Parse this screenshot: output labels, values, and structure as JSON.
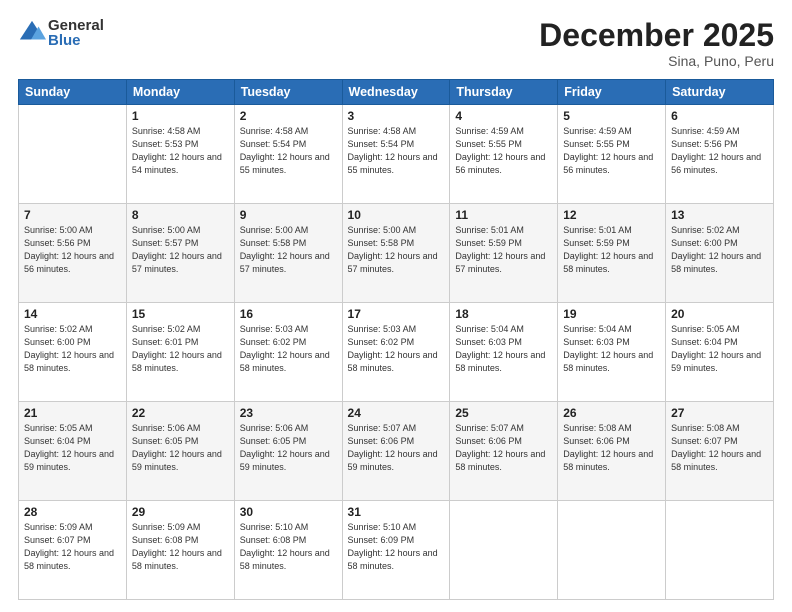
{
  "logo": {
    "general": "General",
    "blue": "Blue"
  },
  "title": "December 2025",
  "location": "Sina, Puno, Peru",
  "headers": [
    "Sunday",
    "Monday",
    "Tuesday",
    "Wednesday",
    "Thursday",
    "Friday",
    "Saturday"
  ],
  "weeks": [
    [
      {
        "day": "",
        "info": ""
      },
      {
        "day": "1",
        "info": "Sunrise: 4:58 AM\nSunset: 5:53 PM\nDaylight: 12 hours\nand 54 minutes."
      },
      {
        "day": "2",
        "info": "Sunrise: 4:58 AM\nSunset: 5:54 PM\nDaylight: 12 hours\nand 55 minutes."
      },
      {
        "day": "3",
        "info": "Sunrise: 4:58 AM\nSunset: 5:54 PM\nDaylight: 12 hours\nand 55 minutes."
      },
      {
        "day": "4",
        "info": "Sunrise: 4:59 AM\nSunset: 5:55 PM\nDaylight: 12 hours\nand 56 minutes."
      },
      {
        "day": "5",
        "info": "Sunrise: 4:59 AM\nSunset: 5:55 PM\nDaylight: 12 hours\nand 56 minutes."
      },
      {
        "day": "6",
        "info": "Sunrise: 4:59 AM\nSunset: 5:56 PM\nDaylight: 12 hours\nand 56 minutes."
      }
    ],
    [
      {
        "day": "7",
        "info": "Sunrise: 5:00 AM\nSunset: 5:56 PM\nDaylight: 12 hours\nand 56 minutes."
      },
      {
        "day": "8",
        "info": "Sunrise: 5:00 AM\nSunset: 5:57 PM\nDaylight: 12 hours\nand 57 minutes."
      },
      {
        "day": "9",
        "info": "Sunrise: 5:00 AM\nSunset: 5:58 PM\nDaylight: 12 hours\nand 57 minutes."
      },
      {
        "day": "10",
        "info": "Sunrise: 5:00 AM\nSunset: 5:58 PM\nDaylight: 12 hours\nand 57 minutes."
      },
      {
        "day": "11",
        "info": "Sunrise: 5:01 AM\nSunset: 5:59 PM\nDaylight: 12 hours\nand 57 minutes."
      },
      {
        "day": "12",
        "info": "Sunrise: 5:01 AM\nSunset: 5:59 PM\nDaylight: 12 hours\nand 58 minutes."
      },
      {
        "day": "13",
        "info": "Sunrise: 5:02 AM\nSunset: 6:00 PM\nDaylight: 12 hours\nand 58 minutes."
      }
    ],
    [
      {
        "day": "14",
        "info": "Sunrise: 5:02 AM\nSunset: 6:00 PM\nDaylight: 12 hours\nand 58 minutes."
      },
      {
        "day": "15",
        "info": "Sunrise: 5:02 AM\nSunset: 6:01 PM\nDaylight: 12 hours\nand 58 minutes."
      },
      {
        "day": "16",
        "info": "Sunrise: 5:03 AM\nSunset: 6:02 PM\nDaylight: 12 hours\nand 58 minutes."
      },
      {
        "day": "17",
        "info": "Sunrise: 5:03 AM\nSunset: 6:02 PM\nDaylight: 12 hours\nand 58 minutes."
      },
      {
        "day": "18",
        "info": "Sunrise: 5:04 AM\nSunset: 6:03 PM\nDaylight: 12 hours\nand 58 minutes."
      },
      {
        "day": "19",
        "info": "Sunrise: 5:04 AM\nSunset: 6:03 PM\nDaylight: 12 hours\nand 58 minutes."
      },
      {
        "day": "20",
        "info": "Sunrise: 5:05 AM\nSunset: 6:04 PM\nDaylight: 12 hours\nand 59 minutes."
      }
    ],
    [
      {
        "day": "21",
        "info": "Sunrise: 5:05 AM\nSunset: 6:04 PM\nDaylight: 12 hours\nand 59 minutes."
      },
      {
        "day": "22",
        "info": "Sunrise: 5:06 AM\nSunset: 6:05 PM\nDaylight: 12 hours\nand 59 minutes."
      },
      {
        "day": "23",
        "info": "Sunrise: 5:06 AM\nSunset: 6:05 PM\nDaylight: 12 hours\nand 59 minutes."
      },
      {
        "day": "24",
        "info": "Sunrise: 5:07 AM\nSunset: 6:06 PM\nDaylight: 12 hours\nand 59 minutes."
      },
      {
        "day": "25",
        "info": "Sunrise: 5:07 AM\nSunset: 6:06 PM\nDaylight: 12 hours\nand 58 minutes."
      },
      {
        "day": "26",
        "info": "Sunrise: 5:08 AM\nSunset: 6:06 PM\nDaylight: 12 hours\nand 58 minutes."
      },
      {
        "day": "27",
        "info": "Sunrise: 5:08 AM\nSunset: 6:07 PM\nDaylight: 12 hours\nand 58 minutes."
      }
    ],
    [
      {
        "day": "28",
        "info": "Sunrise: 5:09 AM\nSunset: 6:07 PM\nDaylight: 12 hours\nand 58 minutes."
      },
      {
        "day": "29",
        "info": "Sunrise: 5:09 AM\nSunset: 6:08 PM\nDaylight: 12 hours\nand 58 minutes."
      },
      {
        "day": "30",
        "info": "Sunrise: 5:10 AM\nSunset: 6:08 PM\nDaylight: 12 hours\nand 58 minutes."
      },
      {
        "day": "31",
        "info": "Sunrise: 5:10 AM\nSunset: 6:09 PM\nDaylight: 12 hours\nand 58 minutes."
      },
      {
        "day": "",
        "info": ""
      },
      {
        "day": "",
        "info": ""
      },
      {
        "day": "",
        "info": ""
      }
    ]
  ]
}
